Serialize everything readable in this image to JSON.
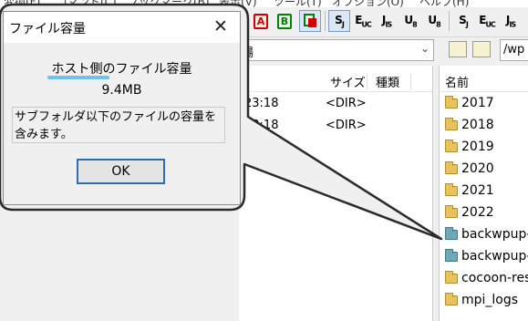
{
  "menu": {
    "items": [
      "変換(F)",
      "コマンド(C)",
      "ブックマーク(B)",
      "表示(V)",
      "ツール(T)",
      "オプション(O)",
      "ヘルプ(H)"
    ]
  },
  "toolbar": {
    "buttons": [
      {
        "label": "A",
        "icon": "ascii-mode-icon",
        "color": "#d00000"
      },
      {
        "label": "B",
        "icon": "binary-mode-icon",
        "color": "#008000"
      },
      {
        "label": "",
        "icon": "auto-mode-icon"
      },
      {
        "label": "SJ",
        "icon": "sjis-icon"
      },
      {
        "label": "EUC",
        "icon": "euc-icon"
      },
      {
        "label": "JIS",
        "icon": "jis-icon"
      },
      {
        "label": "U8",
        "icon": "utf8-icon"
      },
      {
        "label": "U8",
        "icon": "utf8-bom-icon"
      },
      {
        "label": "SJ",
        "icon": "sjis-remote-icon"
      },
      {
        "label": "EUC",
        "icon": "euc-remote-icon"
      },
      {
        "label": "JIS",
        "icon": "jis-remote-icon"
      }
    ]
  },
  "local": {
    "path_fragment": "場",
    "columns": {
      "size": "サイズ",
      "type": "種類"
    },
    "rows": [
      {
        "time": "23:18",
        "size": "<DIR>"
      },
      {
        "time": "23:18",
        "size": "<DIR>"
      }
    ]
  },
  "remote": {
    "path": "/wp",
    "column_name": "名前",
    "items": [
      {
        "name": "2017",
        "icon": "folder-icon"
      },
      {
        "name": "2018",
        "icon": "folder-icon"
      },
      {
        "name": "2019",
        "icon": "folder-icon"
      },
      {
        "name": "2020",
        "icon": "folder-icon"
      },
      {
        "name": "2021",
        "icon": "folder-icon"
      },
      {
        "name": "2022",
        "icon": "folder-icon"
      },
      {
        "name": "backwpup-",
        "icon": "folder-teal-icon"
      },
      {
        "name": "backwpup-",
        "icon": "folder-teal-icon"
      },
      {
        "name": "cocoon-res",
        "icon": "folder-icon"
      },
      {
        "name": "mpi_logs",
        "icon": "folder-icon"
      }
    ]
  },
  "dialog": {
    "title": "ファイル容量",
    "heading": "ホスト側のファイル容量",
    "size": "9.4MB",
    "description": "サブフォルダ以下のファイルの容量を含みます。",
    "ok_label": "OK",
    "close_symbol": "✕"
  },
  "colors": {
    "dialog_bg": "#f0f0f0",
    "ok_border": "#2b6fb3",
    "highlight": "#6fc2e8",
    "folder": "#e8c25a",
    "folder_teal": "#6fa8b8"
  }
}
